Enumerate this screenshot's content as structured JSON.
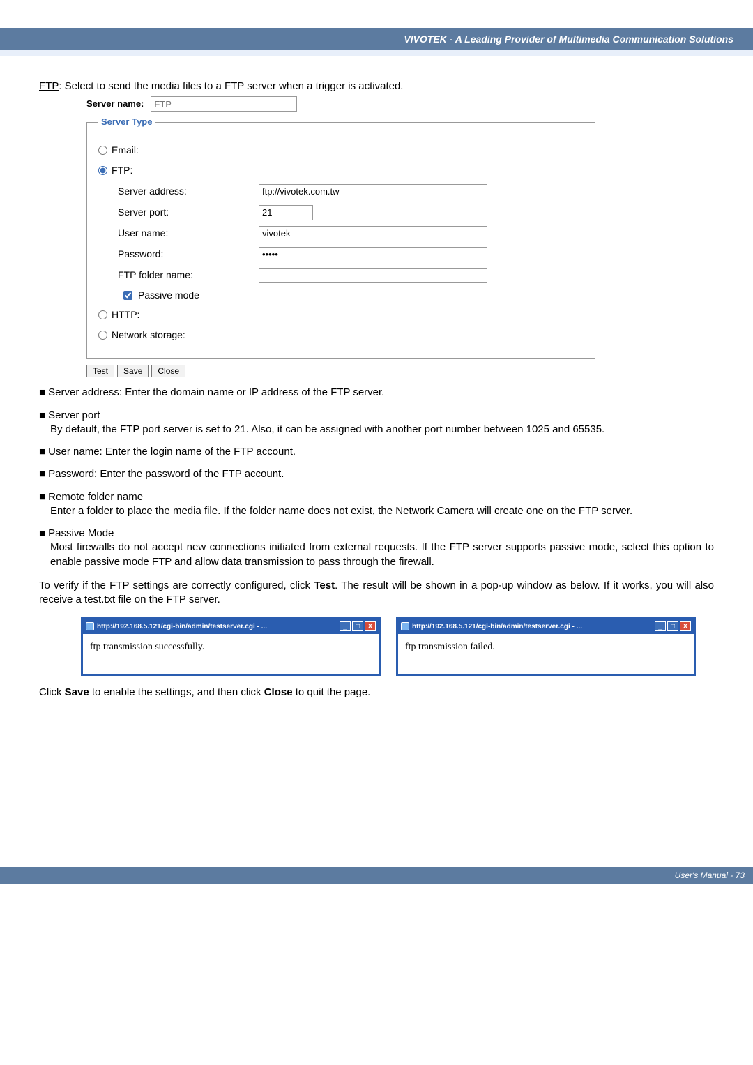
{
  "header": {
    "brand": "VIVOTEK - A Leading Provider of Multimedia Communication Solutions"
  },
  "intro": {
    "ftp_label": "FTP",
    "text": ": Select to send the media files to a FTP server when a trigger is activated."
  },
  "form": {
    "server_name_label": "Server name:",
    "server_name_placeholder": "FTP",
    "legend": "Server Type",
    "radio": {
      "email": "Email:",
      "ftp": "FTP:",
      "http": "HTTP:",
      "net": "Network storage:"
    },
    "fields": {
      "server_address_label": "Server address:",
      "server_address_value": "ftp://vivotek.com.tw",
      "server_port_label": "Server port:",
      "server_port_value": "21",
      "user_name_label": "User name:",
      "user_name_value": "vivotek",
      "password_label": "Password:",
      "password_value": "•••••",
      "folder_label": "FTP folder name:",
      "folder_value": "",
      "passive_label": "Passive mode"
    },
    "buttons": {
      "test": "Test",
      "save": "Save",
      "close": "Close"
    }
  },
  "bullets": {
    "b1": "Server address: Enter the domain name or IP address of the FTP server.",
    "b2_head": "Server port",
    "b2_body": "By default, the FTP port server is set to 21. Also, it can be assigned with another port  number between 1025 and 65535.",
    "b3": "User name: Enter the login name of the FTP account.",
    "b4": "Password: Enter the password of the FTP account.",
    "b5_head": "Remote folder name",
    "b5_body": "Enter a folder to place the media file. If the folder name does not exist, the Network Camera will create one on the FTP server.",
    "b6_head": "Passive Mode",
    "b6_body": "Most firewalls do not accept new connections initiated from external requests. If the FTP server supports passive mode, select this option to enable passive mode FTP and allow data transmission to pass through the firewall."
  },
  "verify": {
    "p1a": "To verify if the FTP settings are correctly configured, click ",
    "p1b": "Test",
    "p1c": ". The result will be shown in a pop-up window as below. If it works, you will also receive a test.txt file on the FTP server."
  },
  "popups": {
    "url": "http://192.168.5.121/cgi-bin/admin/testserver.cgi - ...",
    "ok": "ftp transmission successfully.",
    "fail": "ftp transmission failed."
  },
  "closing": {
    "a": "Click ",
    "b": "Save",
    "c": " to enable the settings,  and then click ",
    "d": "Close",
    "e": " to quit the page."
  },
  "footer": {
    "text": "User's Manual - 73"
  }
}
